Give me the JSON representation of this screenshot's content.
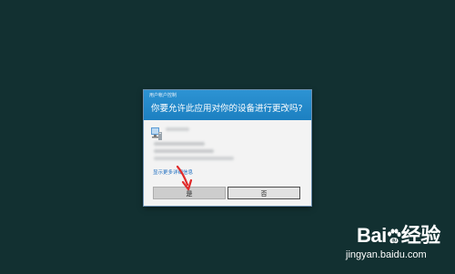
{
  "dialog": {
    "title": "用户帐户控制",
    "question": "你要允许此应用对你的设备进行更改吗?",
    "more_details_link": "显示更多详细信息",
    "yes_button": "是",
    "no_button": "否",
    "header_color": "#1f86c7"
  },
  "watermark": {
    "logo_text_1": "Bai",
    "logo_text_2": "经验",
    "site": "jingyan.baidu.com"
  },
  "colors": {
    "desktop_background": "#123031",
    "annotation_arrow": "#e02a2a"
  },
  "icons": {
    "app": "program-icon",
    "annotation": "red-arrow-icon",
    "watermark_mark": "paw-icon"
  }
}
